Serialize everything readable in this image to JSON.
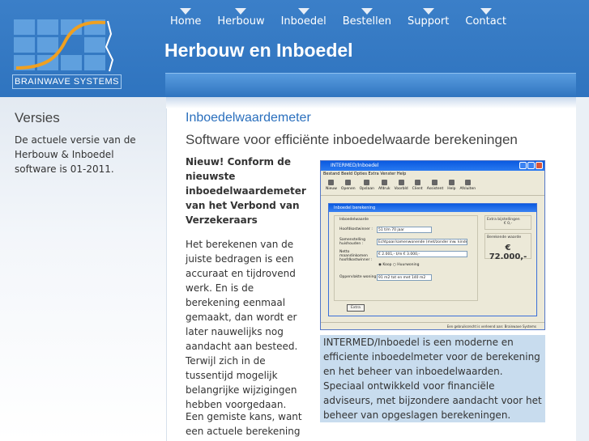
{
  "brand": {
    "logo_text": "BRAINWAVE SYSTEMS"
  },
  "nav": [
    "Home",
    "Herbouw",
    "Inboedel",
    "Bestellen",
    "Support",
    "Contact"
  ],
  "site_title": "Herbouw en Inboedel",
  "sidebar": {
    "title": "Versies",
    "text": "De actuele versie van de Herbouw & Inboedel software is 01-2011."
  },
  "main": {
    "subtitle": "Inboedelwaardemeter",
    "tagline": "Software voor efficiënte inboedelwaarde berekeningen",
    "intro": "Nieuw! Conform de nieuwste inboedelwaardemeter van het Verbond van Verzekeraars",
    "para1": "Het berekenen van de juiste bedragen is een accuraat en tijdrovend werk. En is de berekening eenmaal gemaakt, dan wordt er later nauwelijks nog aandacht aan besteed. Terwijl zich in de tussentijd mogelijk belangrijke wijzigingen hebben voorgedaan.",
    "para2": "Een gemiste kans, want een actuele berekening",
    "caption": "INTERMED/Inboedel is een moderne en efficiente inboedelmeter voor de berekening en het beheer van inboedelwaarden. Speciaal ontwikkeld voor financiële adviseurs, met bijzondere aandacht voor het beheer van opgeslagen berekeningen."
  },
  "screenshot": {
    "window_title": "INTERMED/Inboedel",
    "menu": "Bestand  Beeld  Opties  Extra  Venster  Help",
    "tools": [
      "Nieuw",
      "Openen",
      "Opslaan",
      "Afdruk",
      "Voorbld",
      "Client",
      "Assistent",
      "Help",
      "Afsluiten"
    ],
    "dialog_title": "Inboedel berekening",
    "group_label": "Inboedelwaarde",
    "field_age_label": "Hoofdkostwinner :",
    "field_age_value": "51 t/m 70 jaar",
    "field_house_label": "Samenstelling huishouden :",
    "field_house_value": "Echtpaar/samenwonende (met/zonder inw. kinde",
    "field_income_label": "Netto maandinkomen hoofdkostwinner :",
    "field_income_value": "€ 2.001,- t/m € 3.000,-",
    "radio_koop": "Koop",
    "radio_huur": "Huurwoning",
    "field_area_label": "Oppervlakte woning :",
    "field_area_value": "91 m2 tot en met 140 m2",
    "extra_label": "Extra bijstellingen",
    "extra_value": "€ 0,-",
    "bere_label": "Berekende waarde",
    "bere_value": "€ 72.000,-",
    "button_extra": "Extra",
    "status": "Een gebruiksrecht is verleend aan: Brainwave Systems"
  }
}
